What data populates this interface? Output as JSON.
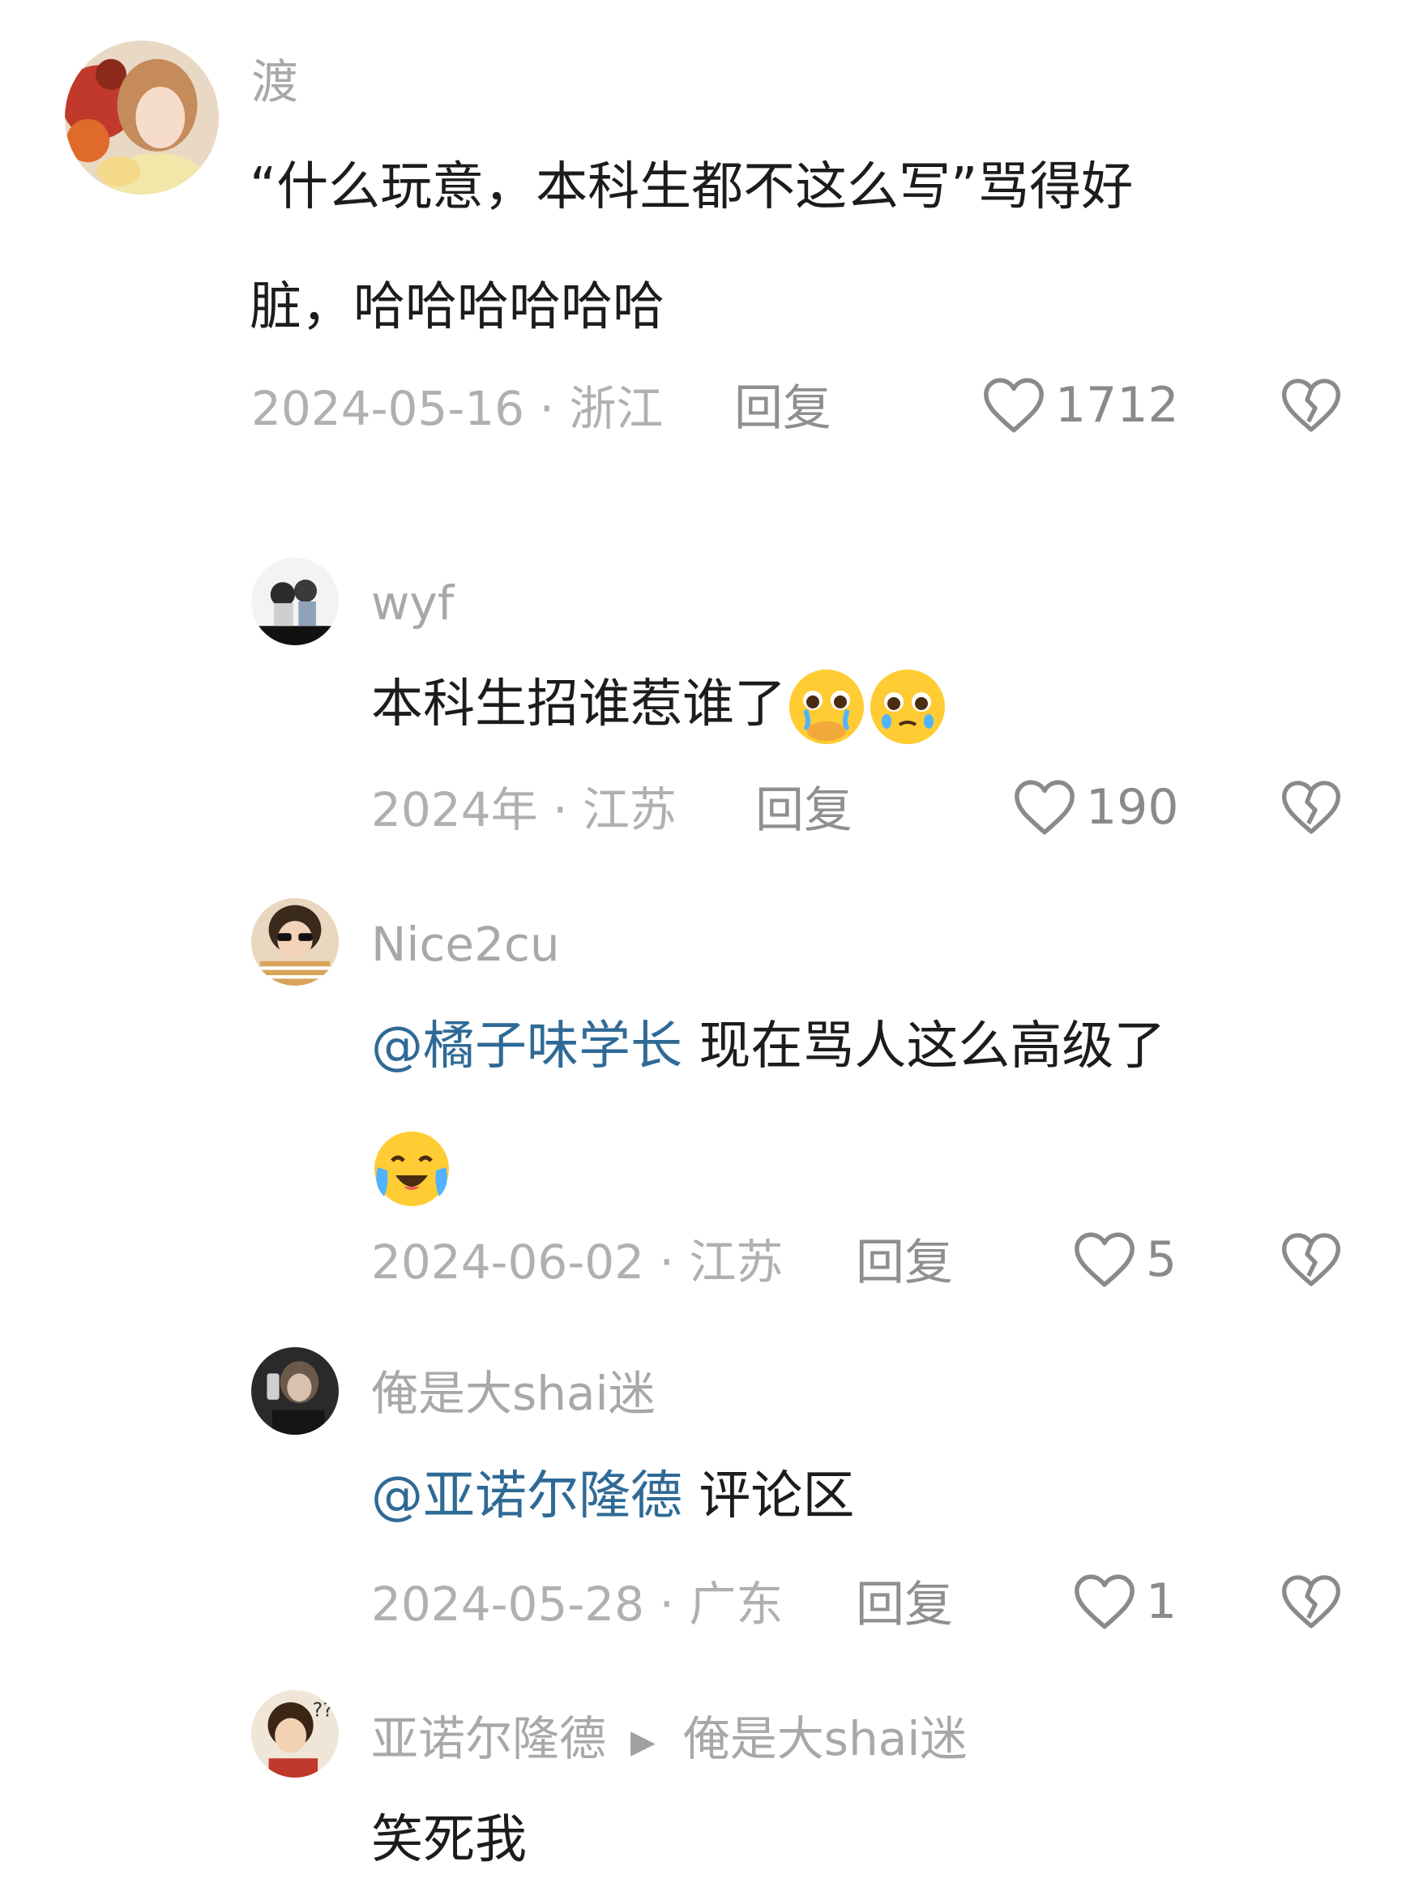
{
  "comments": [
    {
      "username": "渡",
      "line1": "“什么玩意，本科生都不这么写”骂得好",
      "line2": "脏，哈哈哈哈哈哈",
      "meta": "2024-05-16 · 浙江",
      "reply_label": "回复",
      "likes": "1712",
      "avatar_icon": "avatar-girl-flowers"
    },
    {
      "username": "wyf",
      "text": "本科生招谁惹谁了",
      "emojis": [
        "pleading-hands-emoji",
        "pleading-tear-emoji"
      ],
      "meta": "2024年 · 江苏",
      "reply_label": "回复",
      "likes": "190",
      "avatar_icon": "avatar-couple-photo"
    },
    {
      "username": "Nice2cu",
      "mention": "@橘子味学长",
      "text": " 现在骂人这么高级了",
      "emojis": [
        "crying-laughing-emoji"
      ],
      "meta": "2024-06-02 · 江苏",
      "reply_label": "回复",
      "likes": "5",
      "avatar_icon": "avatar-sunglasses"
    },
    {
      "username": "俺是大shai迷",
      "mention": "@亚诺尔隆德",
      "text": " 评论区",
      "meta": "2024-05-28 · 广东",
      "reply_label": "回复",
      "likes": "1",
      "avatar_icon": "avatar-dark-portrait"
    },
    {
      "username": "亚诺尔隆德",
      "reply_to": "俺是大shai迷",
      "text": "笑死我",
      "avatar_icon": "avatar-child-question"
    }
  ],
  "icons": {
    "like": "heart-outline-icon",
    "dislike": "broken-heart-icon",
    "reply_arrow": "triangle-right-icon"
  },
  "colors": {
    "mention": "#2f6a96",
    "username": "#a8a8a8",
    "meta": "#b0b0b0",
    "text": "#1c1c1c"
  }
}
